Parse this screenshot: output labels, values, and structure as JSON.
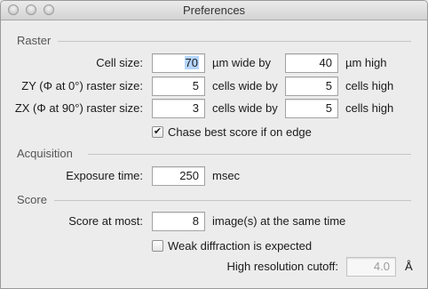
{
  "window": {
    "title": "Preferences"
  },
  "raster": {
    "header": "Raster",
    "cell_size_label": "Cell size:",
    "cell_wide_value": "70",
    "cell_wide_unit": "µm wide by",
    "cell_high_value": "40",
    "cell_high_unit": "µm high",
    "zy_label": "ZY (Φ at 0°) raster size:",
    "zy_wide_value": "5",
    "zy_wide_unit": "cells wide by",
    "zy_high_value": "5",
    "zy_high_unit": "cells high",
    "zx_label": "ZX (Φ at 90°) raster size:",
    "zx_wide_value": "3",
    "zx_wide_unit": "cells wide by",
    "zx_high_value": "5",
    "zx_high_unit": "cells high",
    "chase_label": "Chase best score if on edge",
    "chase_checked": true
  },
  "acquisition": {
    "header": "Acquisition",
    "exposure_label": "Exposure time:",
    "exposure_value": "250",
    "exposure_unit": "msec"
  },
  "score": {
    "header": "Score",
    "score_label": "Score at most:",
    "score_value": "8",
    "score_unit": "image(s) at the same time",
    "weak_label": "Weak diffraction is expected",
    "weak_checked": false,
    "cutoff_label": "High resolution cutoff:",
    "cutoff_value": "4.0",
    "cutoff_unit": "Å"
  }
}
